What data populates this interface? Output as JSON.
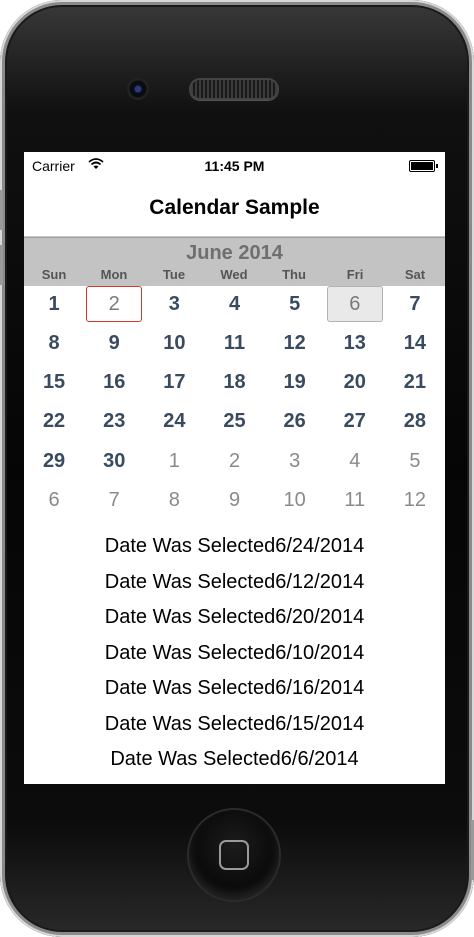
{
  "status_bar": {
    "carrier": "Carrier",
    "time": "11:45 PM"
  },
  "nav_bar": {
    "title": "Calendar Sample"
  },
  "calendar": {
    "month_title": "June 2014",
    "weekdays": [
      "Sun",
      "Mon",
      "Tue",
      "Wed",
      "Thu",
      "Fri",
      "Sat"
    ],
    "weeks": [
      [
        {
          "label": "1",
          "state": "current"
        },
        {
          "label": "2",
          "state": "selected"
        },
        {
          "label": "3",
          "state": "current"
        },
        {
          "label": "4",
          "state": "current"
        },
        {
          "label": "5",
          "state": "current"
        },
        {
          "label": "6",
          "state": "today"
        },
        {
          "label": "7",
          "state": "current"
        }
      ],
      [
        {
          "label": "8",
          "state": "current"
        },
        {
          "label": "9",
          "state": "current"
        },
        {
          "label": "10",
          "state": "current"
        },
        {
          "label": "11",
          "state": "current"
        },
        {
          "label": "12",
          "state": "current"
        },
        {
          "label": "13",
          "state": "current"
        },
        {
          "label": "14",
          "state": "current"
        }
      ],
      [
        {
          "label": "15",
          "state": "current"
        },
        {
          "label": "16",
          "state": "current"
        },
        {
          "label": "17",
          "state": "current"
        },
        {
          "label": "18",
          "state": "current"
        },
        {
          "label": "19",
          "state": "current"
        },
        {
          "label": "20",
          "state": "current"
        },
        {
          "label": "21",
          "state": "current"
        }
      ],
      [
        {
          "label": "22",
          "state": "current"
        },
        {
          "label": "23",
          "state": "current"
        },
        {
          "label": "24",
          "state": "current"
        },
        {
          "label": "25",
          "state": "current"
        },
        {
          "label": "26",
          "state": "current"
        },
        {
          "label": "27",
          "state": "current"
        },
        {
          "label": "28",
          "state": "current"
        }
      ],
      [
        {
          "label": "29",
          "state": "current"
        },
        {
          "label": "30",
          "state": "current"
        },
        {
          "label": "1",
          "state": "other"
        },
        {
          "label": "2",
          "state": "other"
        },
        {
          "label": "3",
          "state": "other"
        },
        {
          "label": "4",
          "state": "other"
        },
        {
          "label": "5",
          "state": "other"
        }
      ],
      [
        {
          "label": "6",
          "state": "other"
        },
        {
          "label": "7",
          "state": "other"
        },
        {
          "label": "8",
          "state": "other"
        },
        {
          "label": "9",
          "state": "other"
        },
        {
          "label": "10",
          "state": "other"
        },
        {
          "label": "11",
          "state": "other"
        },
        {
          "label": "12",
          "state": "other"
        }
      ]
    ]
  },
  "selection_log": [
    "Date Was Selected6/24/2014",
    "Date Was Selected6/12/2014",
    "Date Was Selected6/20/2014",
    "Date Was Selected6/10/2014",
    "Date Was Selected6/16/2014",
    "Date Was Selected6/15/2014",
    "Date Was Selected6/6/2014"
  ],
  "colors": {
    "header_bg": "#c3c3c3",
    "day_text": "#3a4b60",
    "selected_border": "#d23b2b"
  }
}
